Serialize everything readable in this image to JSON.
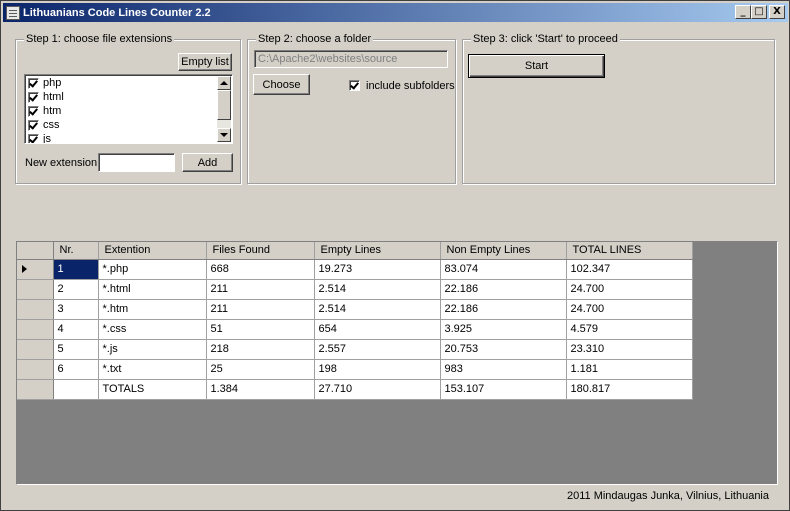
{
  "window": {
    "title": "Lithuanians Code Lines Counter 2.2",
    "buttons": {
      "minimize": "_",
      "maximize": "□",
      "close": "X"
    }
  },
  "step1": {
    "legend": "Step 1: choose file extensions",
    "empty_list_label": "Empty list",
    "extensions": [
      {
        "label": "php",
        "checked": true
      },
      {
        "label": "html",
        "checked": true
      },
      {
        "label": "htm",
        "checked": true
      },
      {
        "label": "css",
        "checked": true
      },
      {
        "label": "js",
        "checked": true
      }
    ],
    "new_extension_label": "New extension",
    "new_extension_value": "",
    "add_label": "Add"
  },
  "step2": {
    "legend": "Step 2: choose a folder",
    "folder_path": "C:\\Apache2\\websites\\source",
    "choose_label": "Choose",
    "include_subfolders_label": "include subfolders",
    "include_subfolders_checked": true
  },
  "step3": {
    "legend": "Step 3: click 'Start' to proceed",
    "start_label": "Start"
  },
  "grid": {
    "columns": [
      "Nr.",
      "Extention",
      "Files Found",
      "Empty Lines",
      "Non Empty Lines",
      "TOTAL LINES"
    ],
    "rows": [
      [
        "1",
        "*.php",
        "668",
        "19.273",
        "83.074",
        "102.347"
      ],
      [
        "2",
        "*.html",
        "211",
        "2.514",
        "22.186",
        "24.700"
      ],
      [
        "3",
        "*.htm",
        "211",
        "2.514",
        "22.186",
        "24.700"
      ],
      [
        "4",
        "*.css",
        "51",
        "654",
        "3.925",
        "4.579"
      ],
      [
        "5",
        "*.js",
        "218",
        "2.557",
        "20.753",
        "23.310"
      ],
      [
        "6",
        "*.txt",
        "25",
        "198",
        "983",
        "1.181"
      ],
      [
        "",
        "TOTALS",
        "1.384",
        "27.710",
        "153.107",
        "180.817"
      ]
    ]
  },
  "footer": {
    "credit": "2011 Mindaugas Junka, Vilnius, Lithuania"
  },
  "colors": {
    "title_start": "#0a246a",
    "title_end": "#a6caf0",
    "face": "#d4d0c8",
    "selection": "#0a246a",
    "grid_bg": "#808080"
  }
}
